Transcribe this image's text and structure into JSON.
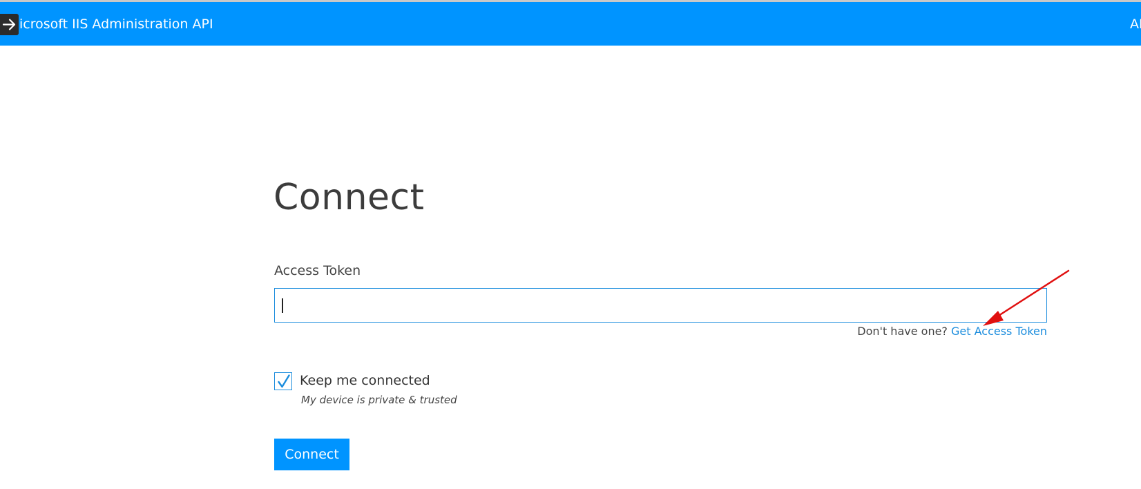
{
  "header": {
    "title": "icrosoft IIS Administration API",
    "right_text": "AI",
    "toggle_icon": "arrow-right-icon",
    "background_color": "#0094ff"
  },
  "main": {
    "title": "Connect",
    "access_token": {
      "label": "Access Token",
      "value": "",
      "placeholder": ""
    },
    "help": {
      "prompt": "Don't have one?",
      "link_label": "Get Access Token"
    },
    "keep_connected": {
      "label": "Keep me connected",
      "sublabel": "My device is private & trusted",
      "checked": true
    },
    "connect_button_label": "Connect"
  },
  "colors": {
    "accent": "#1a8cdd",
    "annotation_arrow": "#e01010"
  }
}
